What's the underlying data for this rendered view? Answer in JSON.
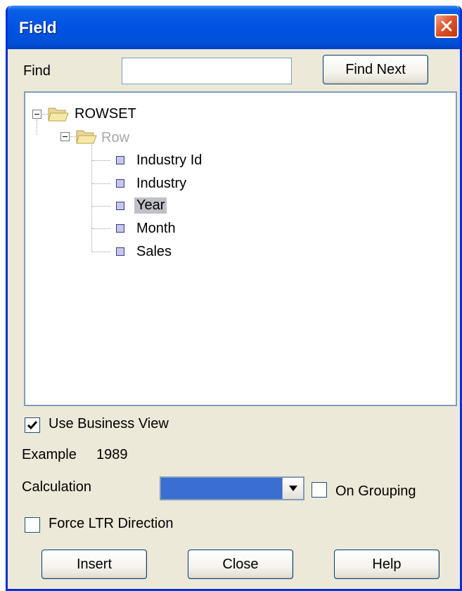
{
  "window": {
    "title": "Field"
  },
  "find": {
    "label": "Find",
    "value": "",
    "button_label": "Find Next"
  },
  "tree": {
    "root": {
      "label": "ROWSET"
    },
    "row": {
      "label": "Row"
    },
    "fields": [
      {
        "label": "Industry Id",
        "selected": false
      },
      {
        "label": "Industry",
        "selected": false
      },
      {
        "label": "Year",
        "selected": true
      },
      {
        "label": "Month",
        "selected": false
      },
      {
        "label": "Sales",
        "selected": false
      }
    ]
  },
  "use_business_view": {
    "label": "Use Business View",
    "checked": true
  },
  "example": {
    "label": "Example",
    "value": "1989"
  },
  "calculation": {
    "label": "Calculation",
    "selected_value": ""
  },
  "on_grouping": {
    "label": "On Grouping",
    "checked": false
  },
  "force_ltr": {
    "label": "Force LTR Direction",
    "checked": false
  },
  "buttons": {
    "insert": "Insert",
    "close": "Close",
    "help": "Help"
  }
}
